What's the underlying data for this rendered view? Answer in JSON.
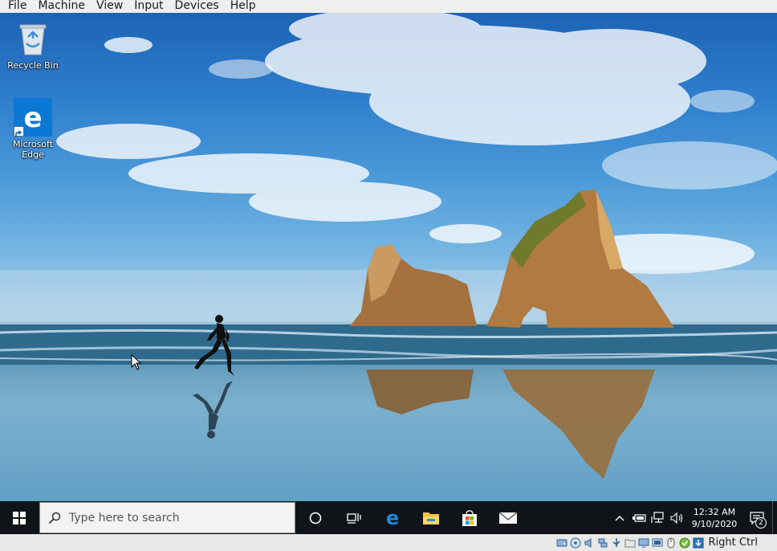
{
  "vbox": {
    "menu": [
      "File",
      "Machine",
      "View",
      "Input",
      "Devices",
      "Help"
    ],
    "host_key": "Right Ctrl",
    "status_icons": [
      "hard-disk-icon",
      "optical-drive-icon",
      "audio-icon",
      "network-icon",
      "usb-icon",
      "shared-folder-icon",
      "display-icon",
      "video-capture-icon",
      "mouse-integration-icon",
      "guest-additions-icon",
      "keyboard-capture-icon"
    ]
  },
  "desktop": {
    "icons": [
      {
        "label": "Recycle Bin",
        "icon": "recycle-bin-icon"
      },
      {
        "label": "Microsoft Edge",
        "icon": "edge-icon"
      }
    ]
  },
  "taskbar": {
    "search_placeholder": "Type here to search",
    "pinned": [
      "cortana-icon",
      "task-view-icon",
      "edge-icon",
      "file-explorer-icon",
      "store-icon",
      "mail-icon"
    ],
    "tray": {
      "time": "12:32 AM",
      "date": "9/10/2020",
      "notification_count": "2",
      "icons": [
        "chevron-up-icon",
        "battery-icon",
        "network-icon",
        "volume-icon"
      ]
    }
  },
  "colors": {
    "taskbar": "#101418",
    "edge_blue": "#0a78d4",
    "vbox_chrome": "#efefee"
  }
}
